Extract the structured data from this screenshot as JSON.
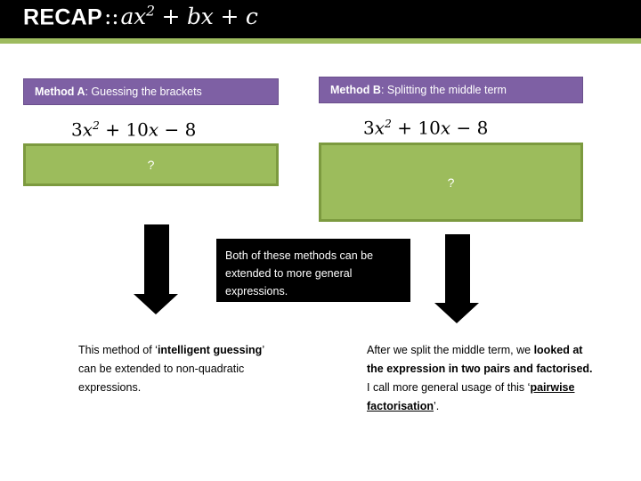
{
  "header": {
    "recap_label": "RECAP",
    "separator": "::",
    "expression_prefix": "ax",
    "expression_exponent": "2",
    "expression_suffix": " + bx + c",
    "background_color": "#000000",
    "stripe_color": "#9ebb5f",
    "text_color": "#ffffff"
  },
  "methods": {
    "a": {
      "label_strong": "Method A",
      "label_rest": ": Guessing the brackets",
      "expression_coefficient": "3",
      "expression_var": "x",
      "expression_exponent": "2",
      "expression_rest": " + 10",
      "expression_var2": "x",
      "expression_tail": " − 8",
      "answer_placeholder": "?",
      "label_color": "#7e60a4",
      "answer_color": "#9cbc5c"
    },
    "b": {
      "label_strong": "Method B",
      "label_rest": ": Splitting the middle term",
      "expression_coefficient": "3",
      "expression_var": "x",
      "expression_exponent": "2",
      "expression_rest": " + 10",
      "expression_var2": "x",
      "expression_tail": " − 8",
      "answer_placeholder": "?",
      "label_color": "#7e60a4",
      "answer_color": "#9cbc5c"
    }
  },
  "central_note": {
    "text": "Both of these methods can be extended to more general expressions.",
    "background_color": "#000000",
    "text_color": "#ffffff"
  },
  "notes": {
    "left": {
      "part1": "This method of ‘",
      "bold1": "intelligent guessing",
      "part2": "’ can be extended to non-quadratic expressions."
    },
    "right": {
      "part1": "After we split the middle term, we ",
      "bold1": "looked at the expression in two pairs and factorised.",
      "part2": "I call more general usage of this ‘",
      "bold_underline": "pairwise factorisation",
      "part3": "’."
    }
  },
  "arrows": {
    "left_label": "down-arrow-method-a",
    "right_label": "down-arrow-method-b",
    "color": "#000000"
  }
}
